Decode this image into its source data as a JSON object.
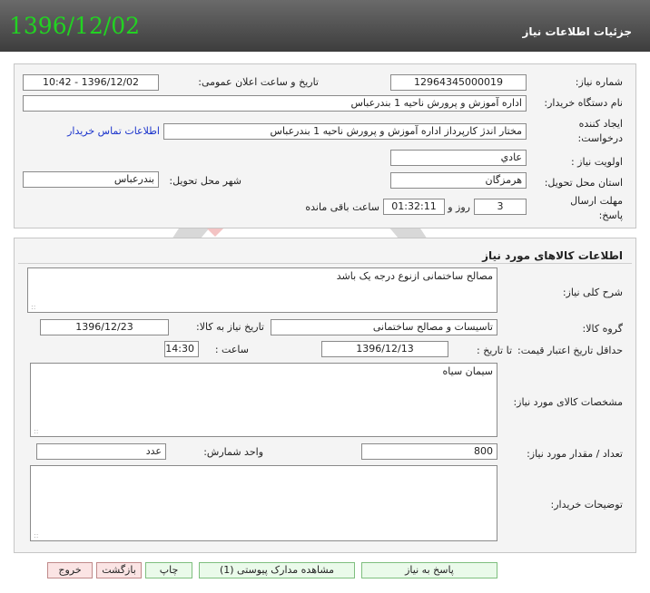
{
  "header": {
    "title": "جزئیات اطلاعات نیاز",
    "date_stamp": "1396/12/02"
  },
  "need_info": {
    "need_number_label": "شماره نیاز:",
    "need_number": "12964345000019",
    "announce_label": "تاریخ و ساعت اعلان عمومی:",
    "announce_value": "1396/12/02 - 10:42",
    "buyer_org_label": "نام دستگاه خریدار:",
    "buyer_org": "اداره آموزش و پرورش ناحیه 1 بندرعباس",
    "creator_label_1": "ایجاد کننده",
    "creator_label_2": "درخواست:",
    "creator": "مختار اندژ کارپرداز اداره آموزش و پرورش ناحیه 1 بندرعباس",
    "contact_link": "اطلاعات تماس خریدار",
    "priority_label": "اولویت نیاز :",
    "priority": "عادي",
    "province_label": "استان محل تحویل:",
    "province": "هرمزگان",
    "city_label": "شهر محل تحویل:",
    "city": "بندرعباس",
    "deadline_label_1": "مهلت ارسال",
    "deadline_label_2": "پاسخ:",
    "deadline_days": "3",
    "days_label": "روز و",
    "deadline_time": "01:32:11",
    "remaining_label": "ساعت باقی مانده"
  },
  "goods": {
    "title": "اطلاعات کالاهای مورد نیاز",
    "summary_label": "شرح کلی نیاز:",
    "summary": "مصالح ساختمانی ازنوع درجه یک باشد",
    "group_label": "گروه کالا:",
    "group": "تاسیسات و مصالح ساختمانی",
    "need_date_label": "تاریخ نیاز به کالا:",
    "need_date": "1396/12/23",
    "validity_label": "حداقل تاریخ اعتبار قیمت:",
    "until_date_label": "تا تاریخ :",
    "until_date": "1396/12/13",
    "time_label": "ساعت :",
    "time": "14:30",
    "spec_label": "مشخصات کالای مورد نیاز:",
    "spec": "سیمان سیاه",
    "qty_label": "تعداد / مقدار مورد نیاز:",
    "qty": "800",
    "unit_label": "واحد شمارش:",
    "unit": "عدد",
    "buyer_notes_label": "توضیحات خریدار:",
    "buyer_notes": ""
  },
  "actions": {
    "reply": "پاسخ به نیاز",
    "view_docs": "مشاهده مدارک پیوستی (1)",
    "print": "چاپ",
    "back": "بازگشت",
    "exit": "خروج"
  },
  "colors": {
    "header_bg": "#4a4a4a",
    "date_green": "#22d322",
    "link_blue": "#1a33cc"
  }
}
